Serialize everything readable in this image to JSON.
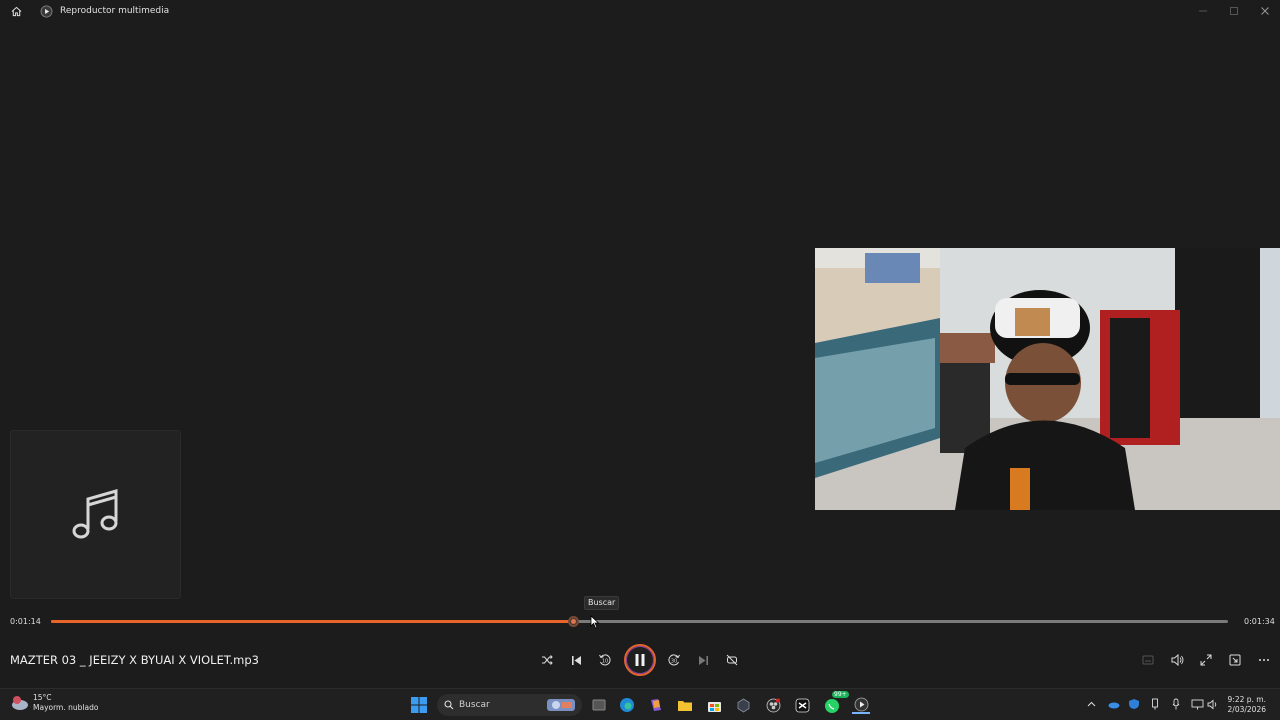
{
  "window": {
    "title": "Reproductor multimedia",
    "home_icon": "home-icon",
    "app_icon": "media-player-icon",
    "controls": [
      "minimize-icon",
      "maximize-icon",
      "close-icon"
    ]
  },
  "album_art": {
    "icon": "music-note-icon"
  },
  "seek": {
    "elapsed": "0:01:14",
    "total": "0:01:34",
    "progress_fraction": 0.444,
    "tooltip": "Buscar"
  },
  "now_playing": {
    "title": "MAZTER 03 _ JEEIZY X BYUAI X VIOLET.mp3"
  },
  "transport": {
    "shuffle": "shuffle-icon",
    "previous": "previous-icon",
    "back10": "10",
    "play_state": "pause-icon",
    "forward30": "30",
    "next": "next-icon",
    "repeat": "repeat-off-icon"
  },
  "taskbar": {
    "weather_temp": "15°C",
    "weather_desc": "Mayorm. nublado",
    "search_placeholder": "Buscar",
    "badge": "99+",
    "time": "9:22 p. m.",
    "date": "2/03/2026"
  },
  "colors": {
    "accent": "#e8652a",
    "background": "#1c1c1c",
    "taskbar": "#202020"
  }
}
